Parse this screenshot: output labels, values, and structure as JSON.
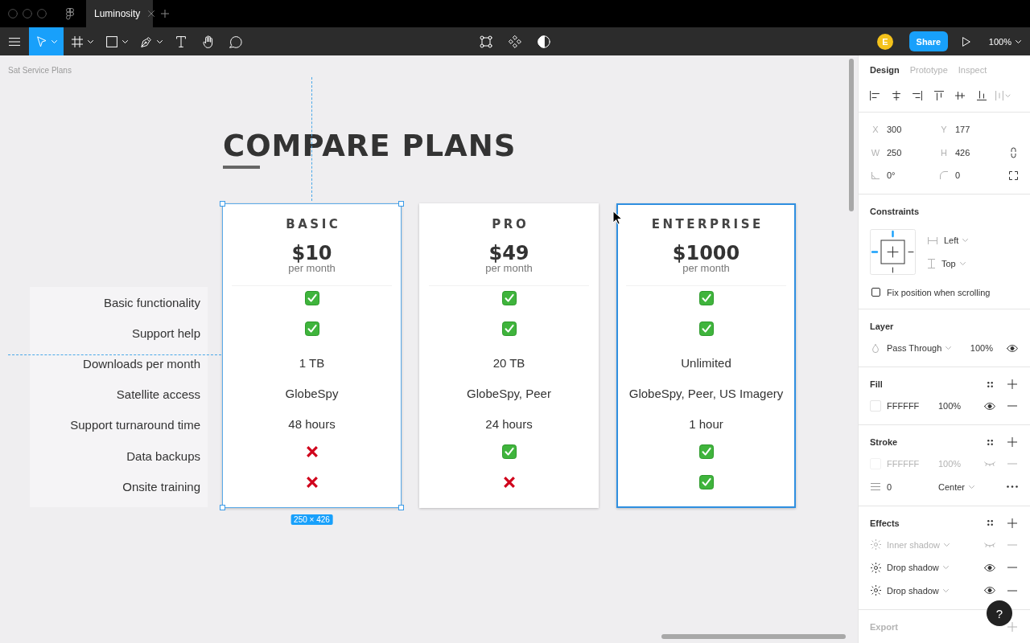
{
  "window": {
    "tab_title": "Luminosity"
  },
  "toolbar": {
    "tools": [
      {
        "kind": "move",
        "selected": true,
        "menu": true
      },
      {
        "kind": "frame",
        "selected": false,
        "menu": true
      },
      {
        "kind": "shape",
        "selected": false,
        "menu": true
      },
      {
        "kind": "pen",
        "selected": false,
        "menu": true
      },
      {
        "kind": "text",
        "selected": false,
        "menu": false
      },
      {
        "kind": "hand",
        "selected": false,
        "menu": false
      },
      {
        "kind": "comment",
        "selected": false,
        "menu": false
      }
    ],
    "avatar": "E",
    "share": "Share",
    "zoom": "100%"
  },
  "canvas": {
    "frame_name": "Sat Service Plans",
    "heading": "COMPARE PLANS",
    "features": [
      "Basic functionality",
      "Support help",
      "Downloads per month",
      "Satellite access",
      "Support turnaround time",
      "Data backups",
      "Onsite training"
    ],
    "plans": [
      {
        "name": "BASIC",
        "price": "$10",
        "period": "per month",
        "selected": true,
        "hovered": false,
        "cells": [
          {
            "kind": "check"
          },
          {
            "kind": "check"
          },
          {
            "kind": "text",
            "text": "1 TB"
          },
          {
            "kind": "text",
            "text": "GlobeSpy"
          },
          {
            "kind": "text",
            "text": "48 hours"
          },
          {
            "kind": "cross"
          },
          {
            "kind": "cross"
          }
        ]
      },
      {
        "name": "PRO",
        "price": "$49",
        "period": "per month",
        "selected": false,
        "hovered": false,
        "cells": [
          {
            "kind": "check"
          },
          {
            "kind": "check"
          },
          {
            "kind": "text",
            "text": "20 TB"
          },
          {
            "kind": "text",
            "text": "GlobeSpy, Peer"
          },
          {
            "kind": "text",
            "text": "24 hours"
          },
          {
            "kind": "check"
          },
          {
            "kind": "cross"
          }
        ]
      },
      {
        "name": "ENTERPRISE",
        "price": "$1000",
        "period": "per month",
        "selected": false,
        "hovered": true,
        "cells": [
          {
            "kind": "check"
          },
          {
            "kind": "check"
          },
          {
            "kind": "text",
            "text": "Unlimited"
          },
          {
            "kind": "text",
            "text": "GlobeSpy, Peer, US Imagery"
          },
          {
            "kind": "text",
            "text": "1 hour"
          },
          {
            "kind": "check"
          },
          {
            "kind": "check"
          }
        ]
      }
    ],
    "selection_size": "250 × 426"
  },
  "panel": {
    "tabs": [
      {
        "label": "Design",
        "selected": true
      },
      {
        "label": "Prototype",
        "selected": false
      },
      {
        "label": "Inspect",
        "selected": false
      }
    ],
    "position": [
      {
        "label": "X",
        "value": "300"
      },
      {
        "label": "Y",
        "value": "177"
      }
    ],
    "size": [
      {
        "label": "W",
        "value": "250"
      },
      {
        "label": "H",
        "value": "426"
      }
    ],
    "rotation": "0°",
    "corner_radius": "0",
    "constraints": {
      "title": "Constraints",
      "horizontal": "Left",
      "vertical": "Top",
      "fix_position": {
        "label": "Fix position when scrolling",
        "checked": false
      }
    },
    "layer": {
      "title": "Layer",
      "blend": "Pass Through",
      "opacity": "100%",
      "visible": true
    },
    "fill": {
      "title": "Fill",
      "items": [
        {
          "hex": "FFFFFF",
          "opacity": "100%",
          "visible": true
        }
      ]
    },
    "stroke": {
      "title": "Stroke",
      "items": [
        {
          "hex": "FFFFFF",
          "opacity": "100%",
          "visible": false
        }
      ],
      "weight": "0",
      "align": "Center"
    },
    "effects": {
      "title": "Effects",
      "items": [
        {
          "name": "Inner shadow",
          "visible": false
        },
        {
          "name": "Drop shadow",
          "visible": true
        },
        {
          "name": "Drop shadow",
          "visible": true
        }
      ]
    },
    "export": {
      "title": "Export"
    },
    "help": "?"
  }
}
